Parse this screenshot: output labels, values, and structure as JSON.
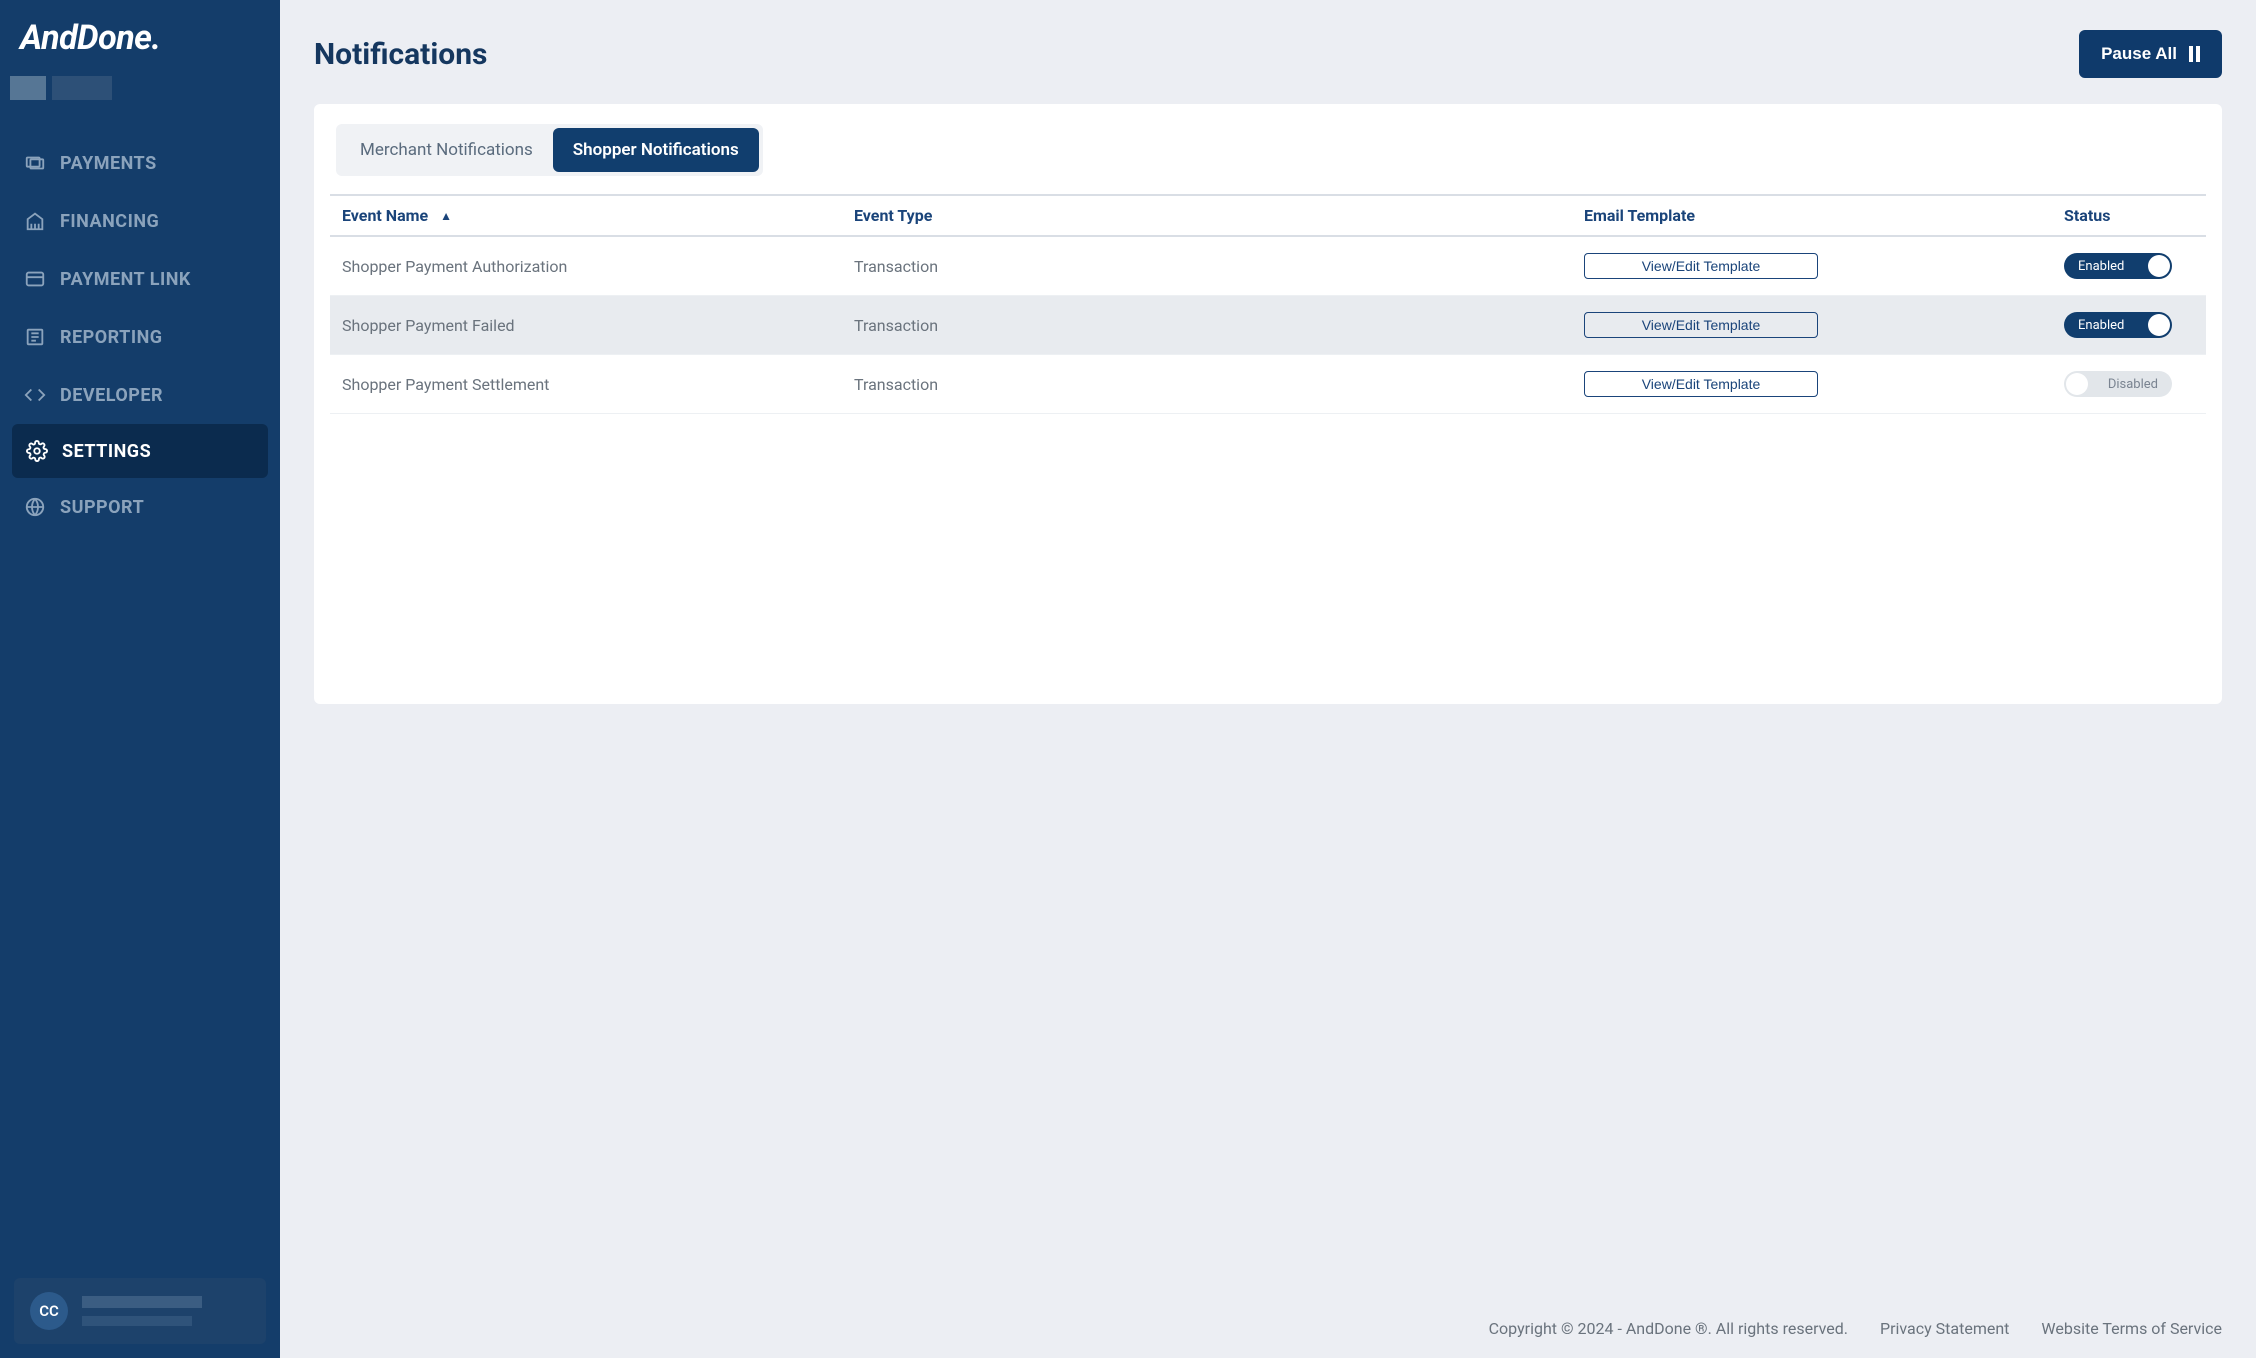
{
  "brand": "AndDone.",
  "sidebar": {
    "items": [
      {
        "label": "PAYMENTS",
        "icon": "payments-icon"
      },
      {
        "label": "FINANCING",
        "icon": "financing-icon"
      },
      {
        "label": "PAYMENT LINK",
        "icon": "payment-link-icon"
      },
      {
        "label": "REPORTING",
        "icon": "reporting-icon"
      },
      {
        "label": "DEVELOPER",
        "icon": "developer-icon"
      },
      {
        "label": "SETTINGS",
        "icon": "settings-icon",
        "active": true
      },
      {
        "label": "SUPPORT",
        "icon": "support-icon"
      }
    ]
  },
  "user": {
    "initials": "CC"
  },
  "header": {
    "title": "Notifications",
    "pause_label": "Pause All"
  },
  "tabs": [
    {
      "label": "Merchant Notifications"
    },
    {
      "label": "Shopper Notifications",
      "active": true
    }
  ],
  "columns": {
    "name": "Event Name",
    "type": "Event Type",
    "template": "Email Template",
    "status": "Status"
  },
  "template_btn_label": "View/Edit Template",
  "status_labels": {
    "enabled": "Enabled",
    "disabled": "Disabled"
  },
  "rows": [
    {
      "name": "Shopper Payment Authorization",
      "type": "Transaction",
      "status": "enabled"
    },
    {
      "name": "Shopper Payment Failed",
      "type": "Transaction",
      "status": "enabled",
      "highlight": true
    },
    {
      "name": "Shopper Payment Settlement",
      "type": "Transaction",
      "status": "disabled"
    }
  ],
  "footer": {
    "copyright": "Copyright © 2024 - AndDone ®. All rights reserved.",
    "privacy": "Privacy Statement",
    "terms": "Website Terms of Service"
  }
}
